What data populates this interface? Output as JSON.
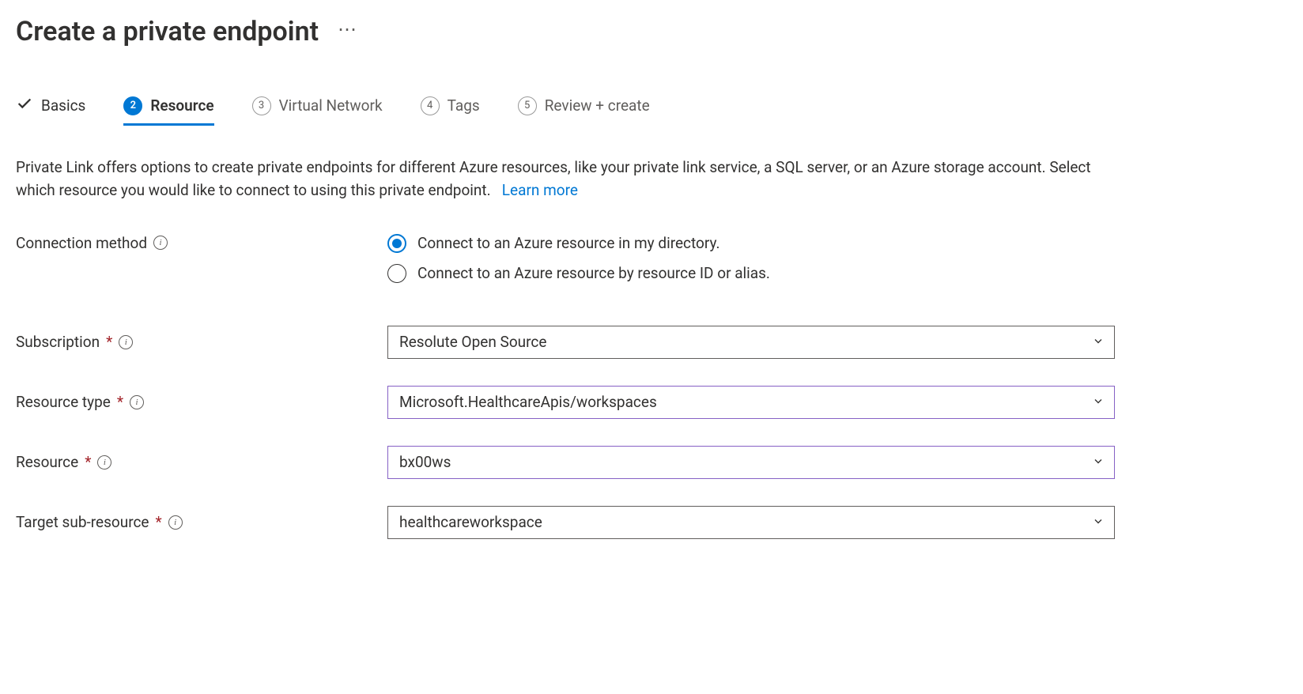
{
  "header": {
    "title": "Create a private endpoint"
  },
  "tabs": {
    "basics": "Basics",
    "resource": {
      "num": "2",
      "label": "Resource"
    },
    "vnet": {
      "num": "3",
      "label": "Virtual Network"
    },
    "tags": {
      "num": "4",
      "label": "Tags"
    },
    "review": {
      "num": "5",
      "label": "Review + create"
    }
  },
  "description": {
    "text": "Private Link offers options to create private endpoints for different Azure resources, like your private link service, a SQL server, or an Azure storage account. Select which resource you would like to connect to using this private endpoint.",
    "learn_more": "Learn more"
  },
  "form": {
    "connection_method": {
      "label": "Connection method",
      "options": {
        "directory": "Connect to an Azure resource in my directory.",
        "resource_id": "Connect to an Azure resource by resource ID or alias."
      }
    },
    "subscription": {
      "label": "Subscription",
      "value": "Resolute Open Source"
    },
    "resource_type": {
      "label": "Resource type",
      "value": "Microsoft.HealthcareApis/workspaces"
    },
    "resource": {
      "label": "Resource",
      "value": "bx00ws"
    },
    "target_sub_resource": {
      "label": "Target sub-resource",
      "value": "healthcareworkspace"
    }
  }
}
